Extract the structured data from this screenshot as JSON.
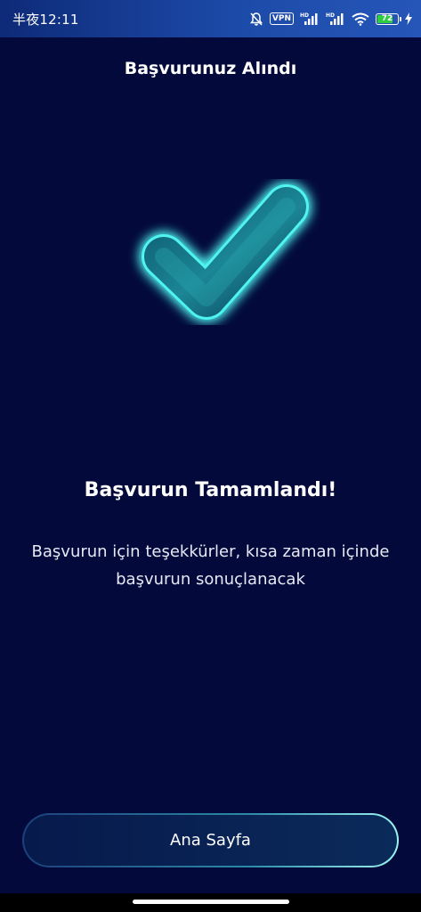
{
  "status_bar": {
    "time": "半夜12:11",
    "vpn_label": "VPN",
    "battery_level": "72",
    "icons": [
      "mute-bell-icon",
      "vpn-icon",
      "hd-signal-icon",
      "hd-signal-icon",
      "wifi-icon",
      "battery-icon",
      "charging-bolt-icon"
    ]
  },
  "header": {
    "title": "Başvurunuz Alındı"
  },
  "illustration": {
    "icon": "checkmark-icon",
    "glow_color": "#35e3e6"
  },
  "content": {
    "headline": "Başvurun Tamamlandı!",
    "message": "Başvurun için teşekkürler, kısa zaman içinde başvurun sonuçlanacak"
  },
  "actions": {
    "home_label": "Ana Sayfa"
  },
  "colors": {
    "background": "#030a3b",
    "accent": "#35e3e6"
  }
}
